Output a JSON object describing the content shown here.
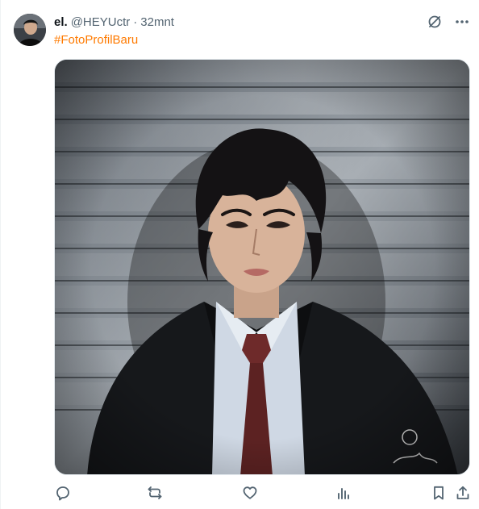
{
  "tweet": {
    "name": "el.",
    "handle": "@HEYUctr",
    "separator": "·",
    "time": "32mnt",
    "hashtag": "#FotoProfilBaru"
  },
  "icons": {
    "grok": "grok-icon",
    "more": "more-icon",
    "reply": "reply-icon",
    "repost": "repost-icon",
    "like": "like-icon",
    "views": "views-icon",
    "bookmark": "bookmark-icon",
    "share": "share-icon"
  },
  "colors": {
    "text": "#0f1419",
    "muted": "#536471",
    "hashtag": "#ff7a00"
  }
}
